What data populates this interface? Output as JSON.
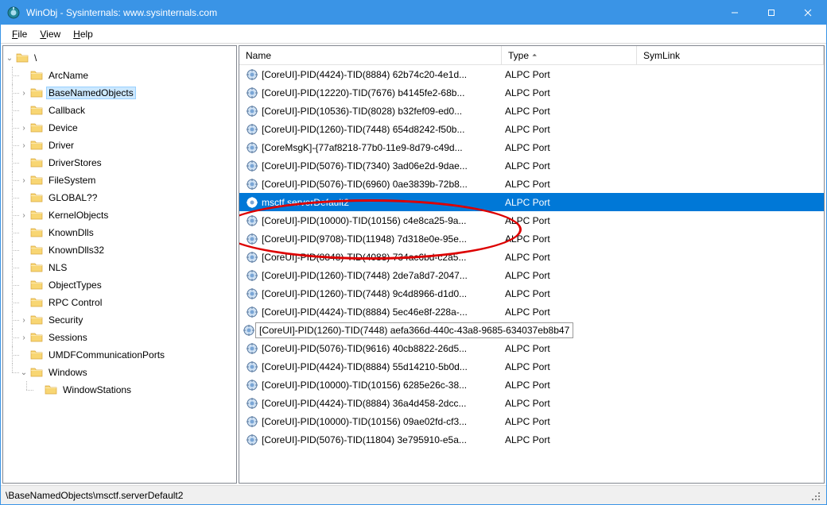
{
  "title": "WinObj - Sysinternals: www.sysinternals.com",
  "menu": {
    "file": "File",
    "view": "View",
    "help": "Help"
  },
  "tree": {
    "root": "\\",
    "items": [
      {
        "label": "ArcName",
        "expandable": false
      },
      {
        "label": "BaseNamedObjects",
        "expandable": true,
        "selected": true
      },
      {
        "label": "Callback",
        "expandable": false
      },
      {
        "label": "Device",
        "expandable": true
      },
      {
        "label": "Driver",
        "expandable": true
      },
      {
        "label": "DriverStores",
        "expandable": false
      },
      {
        "label": "FileSystem",
        "expandable": true
      },
      {
        "label": "GLOBAL??",
        "expandable": false
      },
      {
        "label": "KernelObjects",
        "expandable": true
      },
      {
        "label": "KnownDlls",
        "expandable": false
      },
      {
        "label": "KnownDlls32",
        "expandable": false
      },
      {
        "label": "NLS",
        "expandable": false
      },
      {
        "label": "ObjectTypes",
        "expandable": false
      },
      {
        "label": "RPC Control",
        "expandable": false
      },
      {
        "label": "Security",
        "expandable": true
      },
      {
        "label": "Sessions",
        "expandable": true
      },
      {
        "label": "UMDFCommunicationPorts",
        "expandable": false
      },
      {
        "label": "Windows",
        "expandable": true,
        "expanded": true,
        "children": [
          {
            "label": "WindowStations",
            "expandable": false,
            "last": true
          }
        ]
      }
    ]
  },
  "list": {
    "headers": {
      "name": "Name",
      "type": "Type",
      "symlink": "SymLink",
      "sort_indicator": "⏶"
    },
    "rows": [
      {
        "name": "[CoreUI]-PID(4424)-TID(8884) 62b74c20-4e1d...",
        "type": "ALPC Port"
      },
      {
        "name": "[CoreUI]-PID(12220)-TID(7676) b4145fe2-68b...",
        "type": "ALPC Port"
      },
      {
        "name": "[CoreUI]-PID(10536)-TID(8028) b32fef09-ed0...",
        "type": "ALPC Port"
      },
      {
        "name": "[CoreUI]-PID(1260)-TID(7448) 654d8242-f50b...",
        "type": "ALPC Port"
      },
      {
        "name": "[CoreMsgK]-{77af8218-77b0-11e9-8d79-c49d...",
        "type": "ALPC Port"
      },
      {
        "name": "[CoreUI]-PID(5076)-TID(7340) 3ad06e2d-9dae...",
        "type": "ALPC Port"
      },
      {
        "name": "[CoreUI]-PID(5076)-TID(6960) 0ae3839b-72b8...",
        "type": "ALPC Port"
      },
      {
        "name": "msctf.serverDefault2",
        "type": "ALPC Port",
        "selected": true
      },
      {
        "name": "[CoreUI]-PID(10000)-TID(10156) c4e8ca25-9a...",
        "type": "ALPC Port"
      },
      {
        "name": "[CoreUI]-PID(9708)-TID(11948) 7d318e0e-95e...",
        "type": "ALPC Port"
      },
      {
        "name": "[CoreUI]-PID(8848)-TID(4088) 734ac6bd-c2a5...",
        "type": "ALPC Port"
      },
      {
        "name": "[CoreUI]-PID(1260)-TID(7448) 2de7a8d7-2047...",
        "type": "ALPC Port"
      },
      {
        "name": "[CoreUI]-PID(1260)-TID(7448) 9c4d8966-d1d0...",
        "type": "ALPC Port"
      },
      {
        "name": "[CoreUI]-PID(4424)-TID(8884) 5ec46e8f-228a-...",
        "type": "ALPC Port"
      },
      {
        "name": "[CoreUI]-PID(1260)-TID(7448) aefa366d-440c-43a8-9685-634037eb8b47",
        "type": "",
        "tooltip": true
      },
      {
        "name": "[CoreUI]-PID(5076)-TID(9616) 40cb8822-26d5...",
        "type": "ALPC Port"
      },
      {
        "name": "[CoreUI]-PID(4424)-TID(8884) 55d14210-5b0d...",
        "type": "ALPC Port"
      },
      {
        "name": "[CoreUI]-PID(10000)-TID(10156) 6285e26c-38...",
        "type": "ALPC Port"
      },
      {
        "name": "[CoreUI]-PID(4424)-TID(8884) 36a4d458-2dcc...",
        "type": "ALPC Port"
      },
      {
        "name": "[CoreUI]-PID(10000)-TID(10156) 09ae02fd-cf3...",
        "type": "ALPC Port"
      },
      {
        "name": "[CoreUI]-PID(5076)-TID(11804) 3e795910-e5a...",
        "type": "ALPC Port"
      }
    ]
  },
  "status_path": "\\BaseNamedObjects\\msctf.serverDefault2"
}
